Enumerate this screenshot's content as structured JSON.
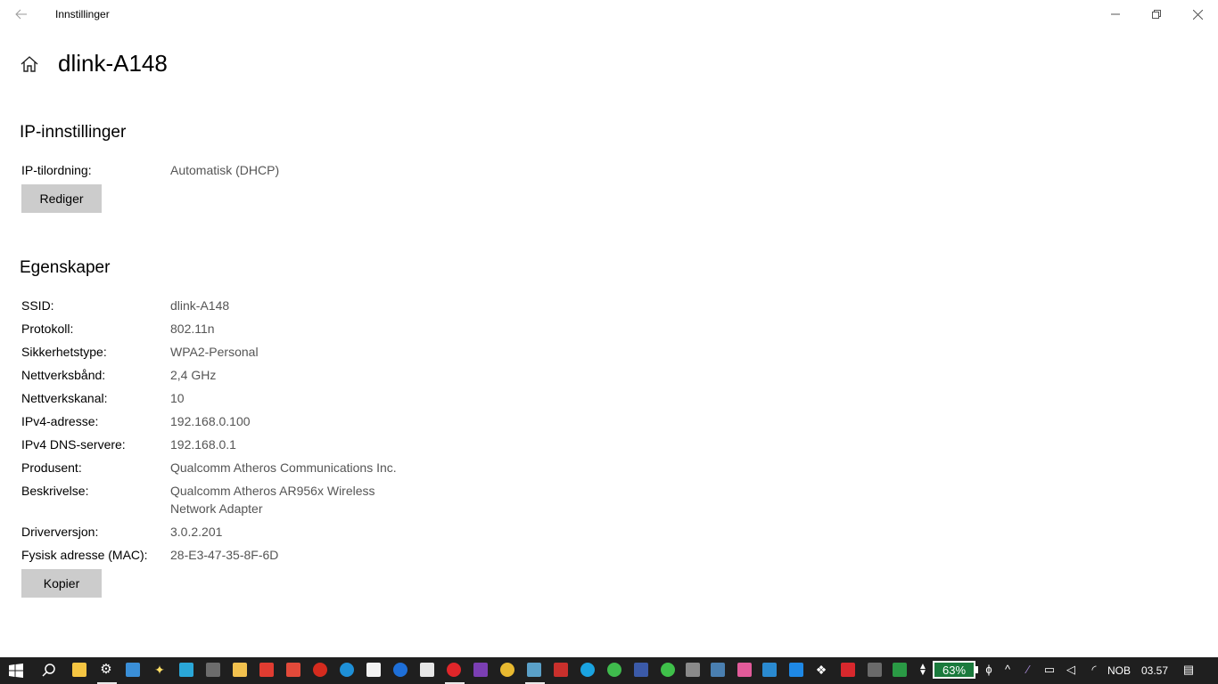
{
  "window": {
    "title": "Innstillinger"
  },
  "header": {
    "title": "dlink-A148"
  },
  "ip_settings": {
    "heading": "IP-innstillinger",
    "assignment_label": "IP-tilordning:",
    "assignment_value": "Automatisk (DHCP)",
    "edit_button": "Rediger"
  },
  "properties": {
    "heading": "Egenskaper",
    "rows": [
      {
        "label": "SSID:",
        "value": "dlink-A148"
      },
      {
        "label": "Protokoll:",
        "value": "802.11n"
      },
      {
        "label": "Sikkerhetstype:",
        "value": "WPA2-Personal"
      },
      {
        "label": "Nettverksbånd:",
        "value": "2,4 GHz"
      },
      {
        "label": "Nettverkskanal:",
        "value": "10"
      },
      {
        "label": "IPv4-adresse:",
        "value": "192.168.0.100"
      },
      {
        "label": "IPv4 DNS-servere:",
        "value": "192.168.0.1"
      },
      {
        "label": "Produsent:",
        "value": "Qualcomm Atheros Communications Inc."
      },
      {
        "label": "Beskrivelse:",
        "value": "Qualcomm Atheros AR956x Wireless Network Adapter"
      },
      {
        "label": "Driverversjon:",
        "value": "3.0.2.201"
      },
      {
        "label": "Fysisk adresse (MAC):",
        "value": "28-E3-47-35-8F-6D"
      }
    ],
    "copy_button": "Kopier"
  },
  "taskbar": {
    "battery_percent": "63%",
    "language": "NOB",
    "clock": "03.57",
    "colors": {
      "background": "#1f1f1f",
      "battery": "#1a7a3c"
    }
  }
}
